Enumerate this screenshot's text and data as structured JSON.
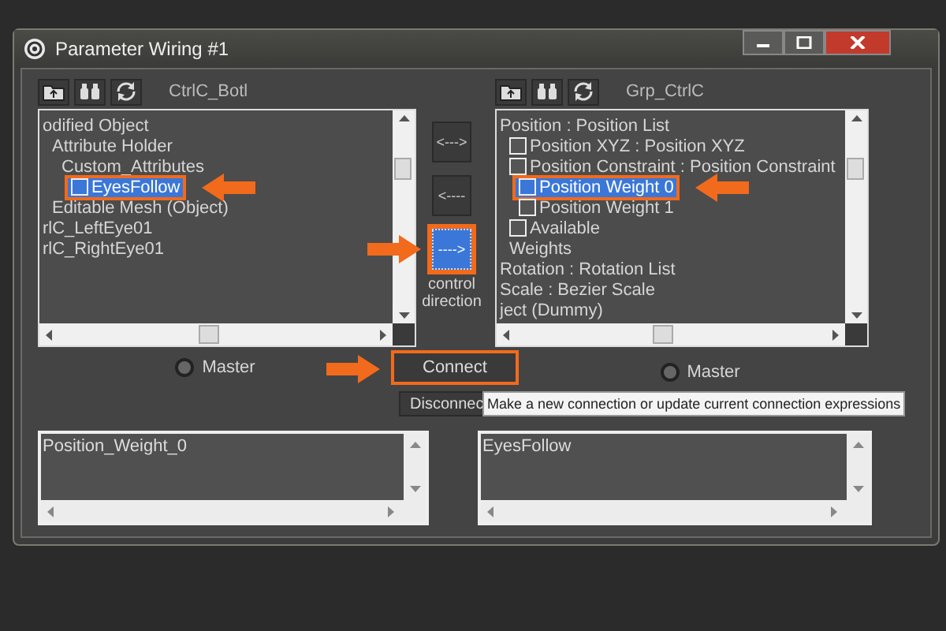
{
  "window": {
    "title": "Parameter Wiring #1"
  },
  "left_panel": {
    "label": "CtrlC_Botl",
    "tree": [
      {
        "label": "odified Object",
        "icon": false,
        "selected": false,
        "highlighted": false,
        "children": [
          {
            "label": "Attribute Holder",
            "icon": false,
            "selected": false,
            "highlighted": false,
            "children": [
              {
                "label": "Custom_Attributes",
                "icon": false,
                "selected": false,
                "highlighted": false,
                "children": [
                  {
                    "label": "EyesFollow",
                    "icon": true,
                    "selected": true,
                    "highlighted": true,
                    "pointed": true
                  }
                ]
              }
            ]
          },
          {
            "label": "Editable Mesh (Object)",
            "icon": false,
            "selected": false,
            "highlighted": false
          }
        ]
      },
      {
        "label": "rlC_LeftEye01",
        "icon": false,
        "selected": false,
        "highlighted": false
      },
      {
        "label": "rlC_RightEye01",
        "icon": false,
        "selected": false,
        "highlighted": false
      }
    ],
    "master": {
      "label": "Master",
      "selected": false
    },
    "expression": "Position_Weight_0"
  },
  "direction_buttons": [
    {
      "label": "<--->",
      "selected": false,
      "highlighted": false
    },
    {
      "label": "<----",
      "selected": false,
      "highlighted": false
    },
    {
      "label": "---->",
      "selected": true,
      "highlighted": true,
      "pointed": true
    }
  ],
  "direction_caption": "control direction",
  "right_panel": {
    "label": "Grp_CtrlC",
    "tree": [
      {
        "label": "Position : Position List",
        "icon": false,
        "selected": false,
        "highlighted": false,
        "children": [
          {
            "label": "Position XYZ : Position XYZ",
            "icon": true,
            "selected": false,
            "highlighted": false
          },
          {
            "label": "Position Constraint : Position Constraint",
            "icon": true,
            "selected": false,
            "highlighted": false,
            "children": [
              {
                "label": "Position Weight 0",
                "icon": true,
                "selected": true,
                "highlighted": true,
                "pointed": true
              },
              {
                "label": "Position Weight 1",
                "icon": true,
                "selected": false,
                "highlighted": false
              }
            ]
          },
          {
            "label": "Available",
            "icon": true,
            "selected": false,
            "highlighted": false
          },
          {
            "label": "Weights",
            "icon": false,
            "selected": false,
            "highlighted": false
          }
        ]
      },
      {
        "label": "Rotation : Rotation List",
        "icon": false,
        "selected": false,
        "highlighted": false
      },
      {
        "label": "Scale : Bezier Scale",
        "icon": false,
        "selected": false,
        "highlighted": false
      },
      {
        "label": "ject (Dummy)",
        "icon": false,
        "selected": false,
        "highlighted": false
      }
    ],
    "master": {
      "label": "Master",
      "selected": false
    },
    "expression": "EyesFollow"
  },
  "actions": [
    {
      "label": "Connect",
      "highlighted": true,
      "pointed": true
    },
    {
      "label": "Disconnec",
      "highlighted": false
    }
  ],
  "tooltip": "Make a new connection or update current connection expressions"
}
